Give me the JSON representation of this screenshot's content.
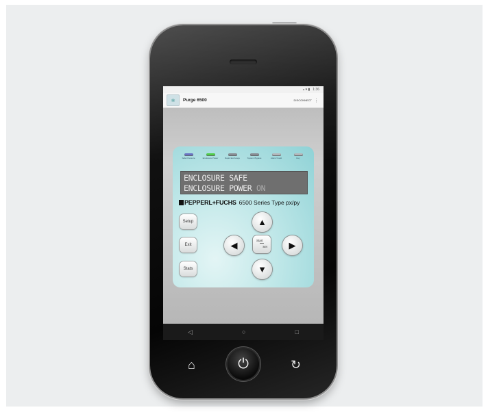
{
  "status_bar": {
    "icons": "⁎ ▾ ▮",
    "time": "1:36"
  },
  "app_bar": {
    "title": "Purge 6500",
    "disconnect_label": "DISCONNECT",
    "menu_glyph": "⋮",
    "logo_glyph": "❀"
  },
  "leds": [
    {
      "label": "Safe Pressure",
      "color": "blue"
    },
    {
      "label": "Enclosure Power",
      "color": "green"
    },
    {
      "label": "Rapid Exchange",
      "color": "gray"
    },
    {
      "label": "System Bypass",
      "color": "gray"
    },
    {
      "label": "Alarm/ Fault",
      "color": "light"
    },
    {
      "label": "Key",
      "color": "light"
    }
  ],
  "lcd": {
    "line1": "ENCLOSURE SAFE",
    "line2": "ENCLOSURE POWER",
    "line2_suffix": "ON"
  },
  "brand": {
    "name": "PEPPERL+FUCHS",
    "series": "6500 Series Type px/py"
  },
  "keys": {
    "setup": "Setup",
    "exit": "Exit",
    "stats": "Stats",
    "start": "Start",
    "set": "Set"
  },
  "arrows": {
    "up": "▲",
    "down": "▼",
    "left": "◀",
    "right": "▶"
  },
  "nav": {
    "back": "◁",
    "home": "○",
    "recent": "□"
  },
  "hardware": {
    "home": "⌂",
    "power": "⏻",
    "back": "↻"
  },
  "colors": {
    "panel": "#bfe7e8",
    "lcd_bg": "#6f6f6f",
    "led_green": "#4fcf48",
    "led_blue": "#6b74c6"
  }
}
